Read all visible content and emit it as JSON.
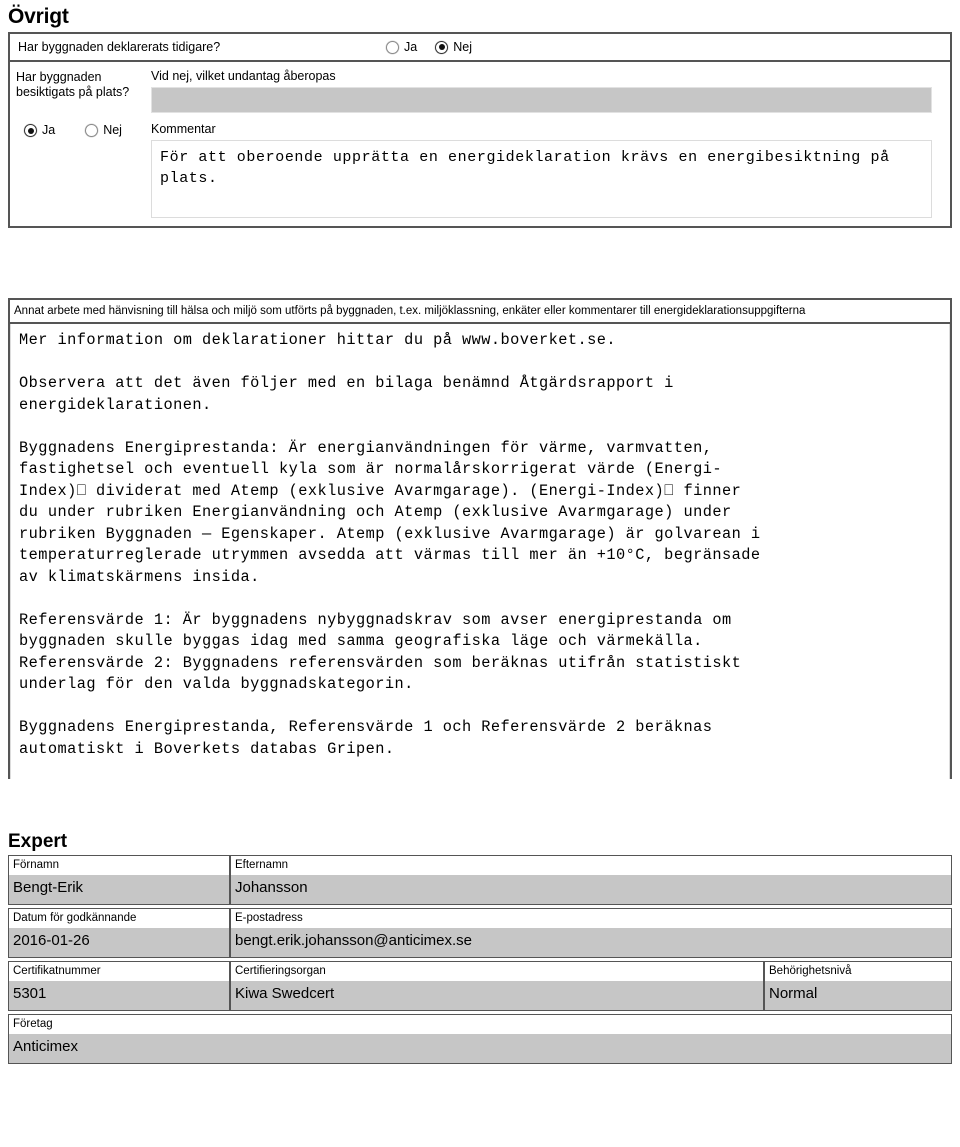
{
  "sections": {
    "ovrigt": {
      "heading": "Övrigt",
      "declared_question": "Har byggnaden deklarerats tidigare?",
      "declared_options": [
        {
          "label": "Ja",
          "checked": false
        },
        {
          "label": "Nej",
          "checked": true
        }
      ],
      "inspected_question_line1": "Har byggnaden",
      "inspected_question_line2": "besiktigats på plats?",
      "inspected_options": [
        {
          "label": "Ja",
          "checked": true
        },
        {
          "label": "Nej",
          "checked": false
        }
      ],
      "exception_label": "Vid nej, vilket undantag åberopas",
      "exception_value": "",
      "comment_label": "Kommentar",
      "comment_value": "För att oberoende upprätta en energideklaration krävs en\nenergibesiktning på plats."
    },
    "annat_arbete": {
      "label": "Annat arbete med hänvisning till hälsa och miljö som utförts på byggnaden, t.ex. miljöklassning, enkäter eller kommentarer till energideklarationsuppgifterna",
      "paragraphs": [
        "Mer information om deklarationer hittar du på www.boverket.se.",
        "Observera att det även följer med en bilaga benämnd Åtgärdsrapport i\nenergideklarationen.",
        "Byggnadens Energiprestanda: Är energianvändningen för värme, varmvatten,\nfastighetsel och eventuell kyla som är normalårskorrigerat värde (Energi-\nIndex)⎕ dividerat med Atemp (exklusive Avarmgarage). (Energi-Index)⎕ finner\ndu under rubriken Energianvändning och Atemp (exklusive Avarmgarage) under\nrubriken Byggnaden — Egenskaper. Atemp (exklusive Avarmgarage) är golvarean i\ntemperaturreglerade utrymmen avsedda att värmas till mer än +10°C, begränsade\nav klimatskärmens insida.",
        "Referensvärde 1: Är byggnadens nybyggnadskrav som avser energiprestanda om\nbyggnaden skulle byggas idag med samma geografiska läge och värmekälla.\nReferensvärde 2: Byggnadens referensvärden som beräknas utifrån statistiskt\nunderlag för den valda byggnadskategorin.",
        "Byggnadens Energiprestanda, Referensvärde 1 och Referensvärde 2 beräknas\nautomatiskt i Boverkets databas Gripen."
      ]
    },
    "expert": {
      "heading": "Expert",
      "fields": {
        "fornamn_label": "Förnamn",
        "fornamn_value": "Bengt-Erik",
        "efternamn_label": "Efternamn",
        "efternamn_value": "Johansson",
        "datum_label": "Datum för godkännande",
        "datum_value": "2016-01-26",
        "epost_label": "E-postadress",
        "epost_value": "bengt.erik.johansson@anticimex.se",
        "certifikatnummer_label": "Certifikatnummer",
        "certifikatnummer_value": "5301",
        "certifieringsorgan_label": "Certifieringsorgan",
        "certifieringsorgan_value": "Kiwa Swedcert",
        "behorighetsniva_label": "Behörighetsnivå",
        "behorighetsniva_value": "Normal",
        "foretag_label": "Företag",
        "foretag_value": "Anticimex"
      }
    }
  },
  "colors": {
    "field_gray": "#c6c6c6",
    "border_dark": "#555555",
    "text": "#000000"
  }
}
